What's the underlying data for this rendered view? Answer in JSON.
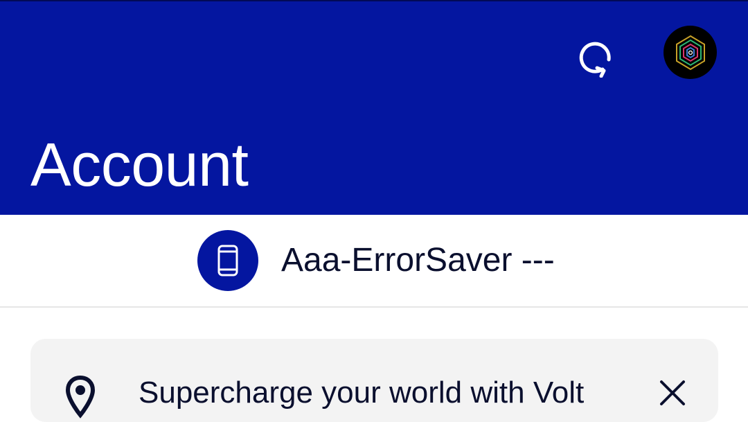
{
  "header": {
    "title": "Account",
    "background_color": "#0416A0",
    "refresh_icon": "refresh-icon",
    "avatar_icon": "hexagon-logo-icon"
  },
  "device": {
    "name": "Aaa-ErrorSaver ---",
    "icon": "smartphone-icon"
  },
  "promo": {
    "text": "Supercharge your world with Volt",
    "icon": "location-pin-icon",
    "close_icon": "close-icon"
  }
}
